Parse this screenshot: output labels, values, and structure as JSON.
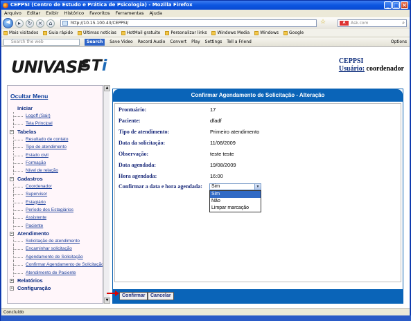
{
  "window": {
    "title": "CEPPSI (Centro de Estudo e Prática de Psicologia) - Mozilla Firefox"
  },
  "menubar": [
    "Arquivo",
    "Editar",
    "Exibir",
    "Histórico",
    "Favoritos",
    "Ferramentas",
    "Ajuda"
  ],
  "nav": {
    "url": "http://10.15.100.43/CEPPSI/",
    "search_placeholder": "Ask.com"
  },
  "bookmarks": [
    "Mais visitados",
    "Guia rápido",
    "Últimas notícias",
    "HotMail gratuito",
    "Personalizar links",
    "Windows Media",
    "Windows",
    "Google"
  ],
  "toolbar2": {
    "search_placeholder": "Search the web",
    "search_btn": "Search",
    "items": [
      "Save Video",
      "Record Audio",
      "Convert",
      "Play",
      "Settings",
      "Tell a Friend"
    ],
    "options": "Options"
  },
  "header": {
    "logo": "UNIVASF",
    "logo2_a": "ST",
    "logo2_b": "i",
    "org": "CEPPSI",
    "user_label": "Usuário:",
    "user_name": "coordenador"
  },
  "sidebar": {
    "toggle": "Ocultar Menu",
    "sections": [
      {
        "title": "Iniciar",
        "items": [
          "Logoff (Sair)",
          "Tela Principal"
        ]
      },
      {
        "title": "Tabelas",
        "items": [
          "Resultado de contato",
          "Tipo de atendimento",
          "Estado civil",
          "Formação",
          "Nível de relação"
        ]
      },
      {
        "title": "Cadastros",
        "items": [
          "Coordenador",
          "Supervisor",
          "Estagiário",
          "Período dos Estagiários",
          "Assistente",
          "Paciente"
        ]
      },
      {
        "title": "Atendimento",
        "items": [
          "Solicitação de atendimento",
          "Encaminhar solicitação",
          "Agendamento de Solicitação",
          "Confirmar Agendamento de Solicitação",
          "Atendimento de Paciente"
        ]
      },
      {
        "title": "Relatórios",
        "items": []
      },
      {
        "title": "Configuração",
        "items": []
      }
    ]
  },
  "main": {
    "title": "Confirmar Agendamento de Solicitação - Alteração",
    "fields": [
      {
        "label": "Prontuário:",
        "value": "17"
      },
      {
        "label": "Paciente:",
        "value": "dfadf"
      },
      {
        "label": "Tipo de atendimento:",
        "value": "Primeiro atendimento"
      },
      {
        "label": "Data da solicitação:",
        "value": "11/08/2009"
      },
      {
        "label": "Observação:",
        "value": "teste teste"
      },
      {
        "label": "Data agendada:",
        "value": "19/08/2009"
      },
      {
        "label": "Hora agendada:",
        "value": "16:00"
      }
    ],
    "confirm_label": "Confirmar a data e hora agendada:",
    "select_value": "Sim",
    "options": [
      "Sim",
      "Não",
      "Limpar marcação"
    ],
    "btn_confirm": "Confirmar",
    "btn_cancel": "Cancelar"
  },
  "status": "Concluído",
  "colors": {
    "accent": "#0a64b8",
    "link": "#1a3e9a"
  }
}
